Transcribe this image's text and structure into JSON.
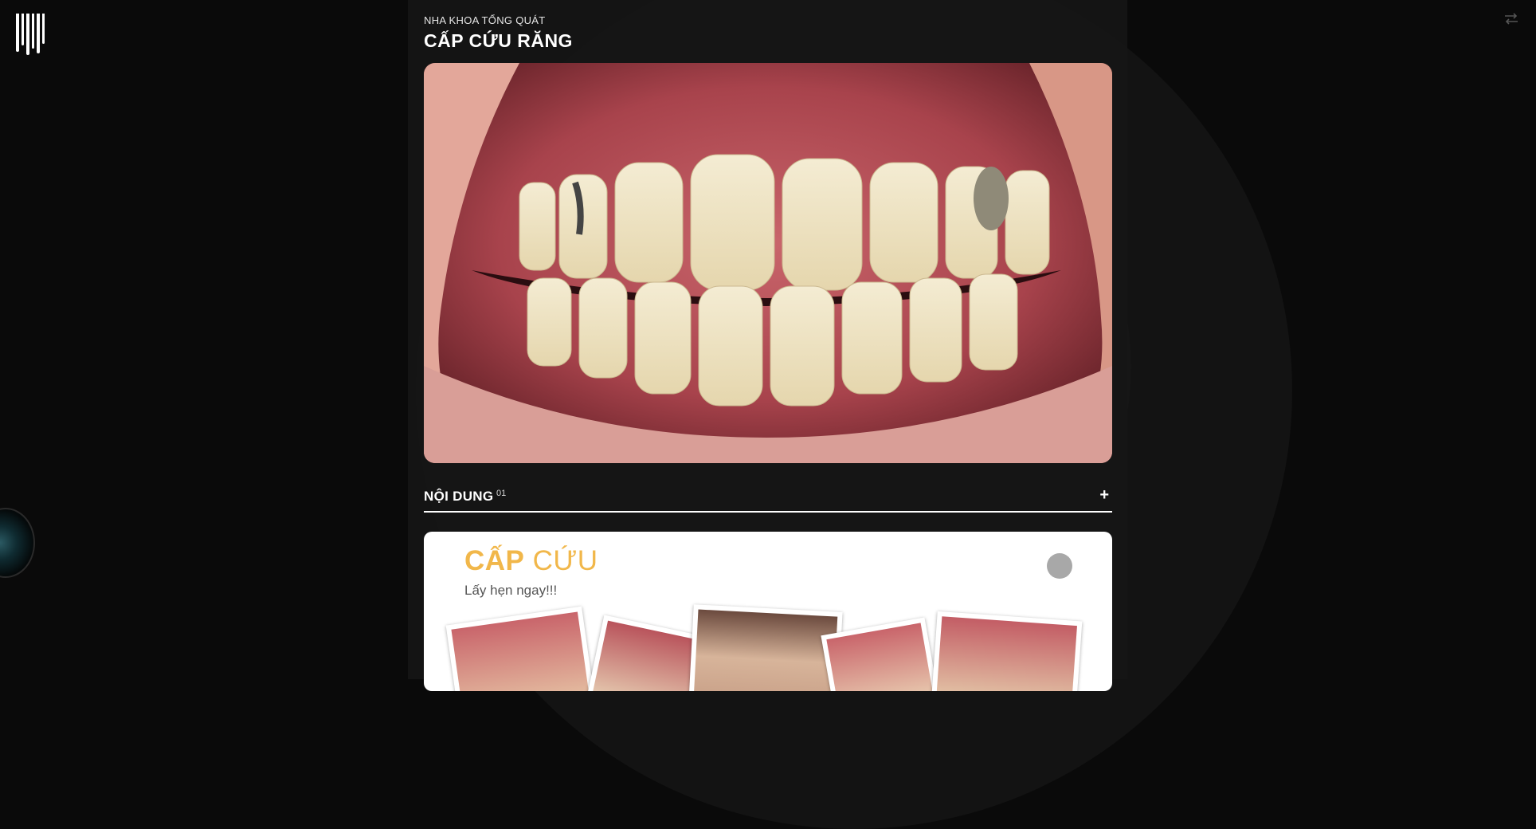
{
  "header": {
    "eyebrow": "NHA KHOA TỔNG QUÁT",
    "title": "CẤP CỨU RĂNG"
  },
  "icons": {
    "logo": "brand-logo-bars",
    "top_right": "swap-arrows-icon",
    "left_orb": "orb-icon"
  },
  "accordion": {
    "label": "NỘI DUNG",
    "number": "01",
    "toggle": "+"
  },
  "card": {
    "title_bold": "CẤP",
    "title_light": "CỨU",
    "subtitle": "Lấy hẹn ngay!!!"
  },
  "colors": {
    "background": "#0a0a0a",
    "panel": "#161616",
    "accent_gold": "#f1b74a"
  }
}
